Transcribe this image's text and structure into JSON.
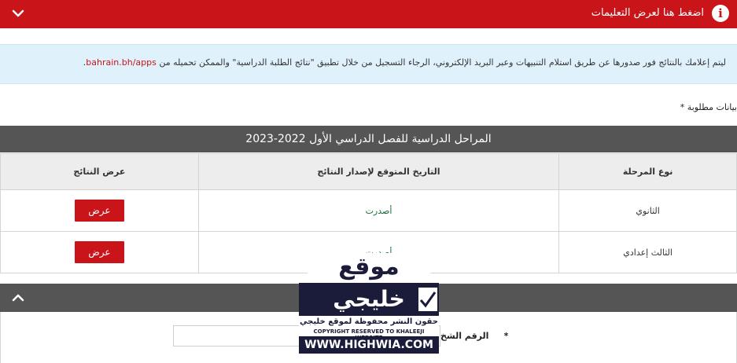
{
  "topbar": {
    "title": "اضغط هنا لعرض التعليمات",
    "info_icon": "info-icon",
    "collapse_icon": "chevron-down-icon"
  },
  "notice": {
    "text": "ليتم إعلامك بالنتائج فور صدورها عن طريق استلام التنبيهات وعبر البريد الإلكتروني، الرجاء التسجيل من خلال تطبيق \"نتائج الطلبة الدراسية\" والممكن تحميله من",
    "link": "bahrain.bh/apps"
  },
  "required_note": "بيانات مطلوبة *",
  "stages": {
    "title": "المراحل الدراسية للفصل الدراسي الأول 2022-2023",
    "headers": [
      "نوع المرحلة",
      "التاريخ المتوقع لإصدار النتائج",
      "عرض النتائج"
    ],
    "rows": [
      {
        "stage": "الثانوي",
        "status": "أصدرت",
        "button": "عرض"
      },
      {
        "stage": "الثالث إعدادي",
        "status": "أصدرت",
        "button": "عرض"
      }
    ]
  },
  "section2": {
    "collapse_icon": "chevron-up-icon",
    "id_label": "الرقم الشخ",
    "id_required": "*",
    "id_value": ""
  },
  "watermark": {
    "line_top": "موقع",
    "line_main": "خليجي",
    "line_rights": "حقون النشر محفوظة لموقع خليجي",
    "line_copyright": "COPYRIGHT RESERVED TO KHALEEJI WEBSITE",
    "line_url": "WWW.HIGHWIA.COM"
  },
  "colors": {
    "brand_red": "#c9141a",
    "header_gray": "#555555",
    "notice_blue": "#dff1fb",
    "status_green": "#1c6a3a"
  }
}
